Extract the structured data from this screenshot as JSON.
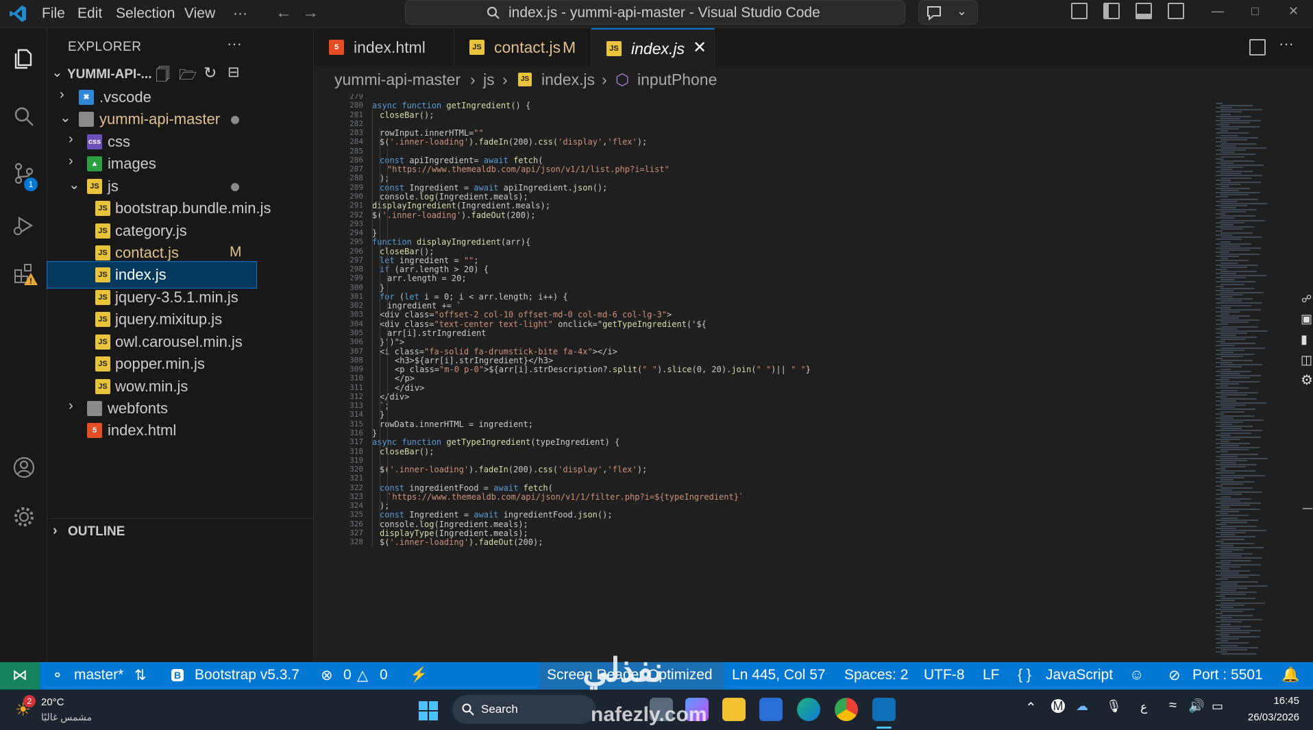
{
  "titlebar": {
    "menus": [
      "File",
      "Edit",
      "Selection",
      "View",
      "···"
    ],
    "title": "index.js - yummi-api-master - Visual Studio Code"
  },
  "activity_bar": {
    "source_control_badge": "1"
  },
  "explorer": {
    "title": "EXPLORER",
    "root_label": "YUMMI-API-...",
    "items": [
      {
        "label": ".vscode",
        "type": "folder",
        "expanded": false,
        "icon": "vscode-folder-icon"
      },
      {
        "label": "yummi-api-master",
        "type": "folder",
        "expanded": true,
        "icon": "folder-icon"
      },
      {
        "label": "css",
        "type": "folder",
        "expanded": false,
        "icon": "css-folder-icon"
      },
      {
        "label": "images",
        "type": "folder",
        "expanded": false,
        "icon": "images-folder-icon"
      },
      {
        "label": "js",
        "type": "folder",
        "expanded": true,
        "icon": "js-folder-icon"
      },
      {
        "label": "bootstrap.bundle.min.js",
        "type": "file",
        "icon": "js-file-icon"
      },
      {
        "label": "category.js",
        "type": "file",
        "icon": "js-file-icon"
      },
      {
        "label": "contact.js",
        "type": "file",
        "icon": "js-file-icon",
        "status": "M"
      },
      {
        "label": "index.js",
        "type": "file",
        "icon": "js-file-icon",
        "selected": true
      },
      {
        "label": "jquery-3.5.1.min.js",
        "type": "file",
        "icon": "js-file-icon"
      },
      {
        "label": "jquery.mixitup.js",
        "type": "file",
        "icon": "js-file-icon"
      },
      {
        "label": "owl.carousel.min.js",
        "type": "file",
        "icon": "js-file-icon"
      },
      {
        "label": "popper.min.js",
        "type": "file",
        "icon": "js-file-icon"
      },
      {
        "label": "wow.min.js",
        "type": "file",
        "icon": "js-file-icon"
      },
      {
        "label": "webfonts",
        "type": "folder",
        "expanded": false,
        "icon": "folder-icon"
      },
      {
        "label": "index.html",
        "type": "file",
        "icon": "html-file-icon"
      }
    ],
    "outline_label": "OUTLINE"
  },
  "tabs": [
    {
      "label": "index.html",
      "icon": "html-file-icon"
    },
    {
      "label": "contact.js",
      "status": "M",
      "icon": "js-file-icon"
    },
    {
      "label": "index.js",
      "active": true,
      "icon": "js-file-icon"
    }
  ],
  "breadcrumb": {
    "root": "yummi-api-master",
    "folder": "js",
    "file": "index.js",
    "symbol": "inputPhone"
  },
  "editor": {
    "lines": [
      {
        "n": "279",
        "indent": 0,
        "text": ""
      },
      {
        "n": "280",
        "indent": 0,
        "text": "async function getIngredient() {"
      },
      {
        "n": "281",
        "indent": 1,
        "text": "closeBar();"
      },
      {
        "n": "282",
        "indent": 1,
        "text": ""
      },
      {
        "n": "283",
        "indent": 1,
        "text": "rowInput.innerHTML=\"\""
      },
      {
        "n": "284",
        "indent": 1,
        "text": "$('.inner-loading').fadeIn(200).css('display','flex');"
      },
      {
        "n": "285",
        "indent": 1,
        "text": ""
      },
      {
        "n": "286",
        "indent": 1,
        "text": "const apiIngredient= await fetch("
      },
      {
        "n": "287",
        "indent": 2,
        "text": "\"https://www.themealdb.com/api/json/v1/1/list.php?i=list\""
      },
      {
        "n": "288",
        "indent": 1,
        "text": ");"
      },
      {
        "n": "289",
        "indent": 1,
        "text": "const Ingredient = await apiIngredient.json();"
      },
      {
        "n": "290",
        "indent": 1,
        "text": "console.log(Ingredient.meals);"
      },
      {
        "n": "291",
        "indent": 0,
        "text": "displayIngredient(Ingredient.meals);"
      },
      {
        "n": "292",
        "indent": 0,
        "text": "$('.inner-loading').fadeOut(200);"
      },
      {
        "n": "293",
        "indent": 0,
        "text": ""
      },
      {
        "n": "294",
        "indent": 0,
        "text": "}"
      },
      {
        "n": "295",
        "indent": 0,
        "text": "function displayIngredient(arr){"
      },
      {
        "n": "296",
        "indent": 1,
        "text": "closeBar();"
      },
      {
        "n": "297",
        "indent": 1,
        "text": "let ingredient = \"\";"
      },
      {
        "n": "298",
        "indent": 1,
        "text": "if (arr.length > 20) {"
      },
      {
        "n": "299",
        "indent": 2,
        "text": "arr.length = 20;"
      },
      {
        "n": "300",
        "indent": 1,
        "text": "}"
      },
      {
        "n": "301",
        "indent": 1,
        "text": "for (let i = 0; i < arr.length; i++) {"
      },
      {
        "n": "302",
        "indent": 2,
        "text": "ingredient += `"
      },
      {
        "n": "303",
        "indent": 1,
        "text": "<div class=\"offset-2 col-10 offset-md-0 col-md-6 col-lg-3\">"
      },
      {
        "n": "304",
        "indent": 1,
        "text": "<div class=\"text-center text-light\" onclick=\"getTypeIngredient('${"
      },
      {
        "n": "305",
        "indent": 2,
        "text": "arr[i].strIngredient"
      },
      {
        "n": "306",
        "indent": 1,
        "text": "}')\">"
      },
      {
        "n": "307",
        "indent": 1,
        "text": "<i class=\"fa-solid fa-drumstick-bite fa-4x\"></i>"
      },
      {
        "n": "308",
        "indent": 3,
        "text": "<h3>${arr[i].strIngredient}</h3>"
      },
      {
        "n": "309",
        "indent": 3,
        "text": "<p class=\"m-0 p-0\">${arr[i].strDescription?.split(\" \").slice(0, 20).join(\" \")|| \" \"}"
      },
      {
        "n": "310",
        "indent": 3,
        "text": "</p>"
      },
      {
        "n": "311",
        "indent": 3,
        "text": "</div>"
      },
      {
        "n": "312",
        "indent": 1,
        "text": "</div>"
      },
      {
        "n": "313",
        "indent": 1,
        "text": "`;"
      },
      {
        "n": "314",
        "indent": 1,
        "text": "}"
      },
      {
        "n": "315",
        "indent": 1,
        "text": "rowData.innerHTML = ingredient;"
      },
      {
        "n": "316",
        "indent": 0,
        "text": "}"
      },
      {
        "n": "317",
        "indent": 0,
        "text": "async function getTypeIngredient(typeIngredient) {"
      },
      {
        "n": "318",
        "indent": 1,
        "text": "closeBar();"
      },
      {
        "n": "319",
        "indent": 1,
        "text": ""
      },
      {
        "n": "320",
        "indent": 1,
        "text": "$('.inner-loading').fadeIn(200).css('display','flex');"
      },
      {
        "n": "321",
        "indent": 1,
        "text": ""
      },
      {
        "n": "322",
        "indent": 1,
        "text": "const ingredientFood = await fetch("
      },
      {
        "n": "323",
        "indent": 2,
        "text": "`https://www.themealdb.com/api/json/v1/1/filter.php?i=${typeIngredient}`"
      },
      {
        "n": "324",
        "indent": 1,
        "text": ");"
      },
      {
        "n": "325",
        "indent": 1,
        "text": "const Ingredient = await ingredientFood.json();"
      },
      {
        "n": "326",
        "indent": 1,
        "text": "console.log(Ingredient.meals);"
      },
      {
        "n": "327",
        "indent": 1,
        "text": "displayType(Ingredient.meals);"
      },
      {
        "n": "328",
        "indent": 1,
        "text": "$('.inner-loading').fadeOut(200);"
      }
    ]
  },
  "statusbar": {
    "branch": "master*",
    "bootstrap": "Bootstrap v5.3.7",
    "errors": "0",
    "warnings": "0",
    "screen_reader": "Screen Reader Optimized",
    "cursor": "Ln 445, Col 57",
    "spaces": "Spaces: 2",
    "encoding": "UTF-8",
    "eol": "LF",
    "language": "JavaScript",
    "port": "Port : 5501"
  },
  "taskbar": {
    "weather_temp": "20°C",
    "weather_desc": "مشمس غالبًا",
    "weather_badge": "2",
    "search_placeholder": "Search",
    "lang": "ع",
    "time": "16:45",
    "date": "26/03/2026"
  },
  "watermark": {
    "arabic": "نفذلي",
    "site": "nafezly.com"
  },
  "colors": {
    "accent": "#0078d4",
    "keyword": "#569cd6",
    "function": "#dcdcaa",
    "string": "#ce9178",
    "variable": "#9cdcfe",
    "js_icon": "#e8c33b",
    "html_icon": "#e44d26",
    "modified": "#e2c08d"
  }
}
